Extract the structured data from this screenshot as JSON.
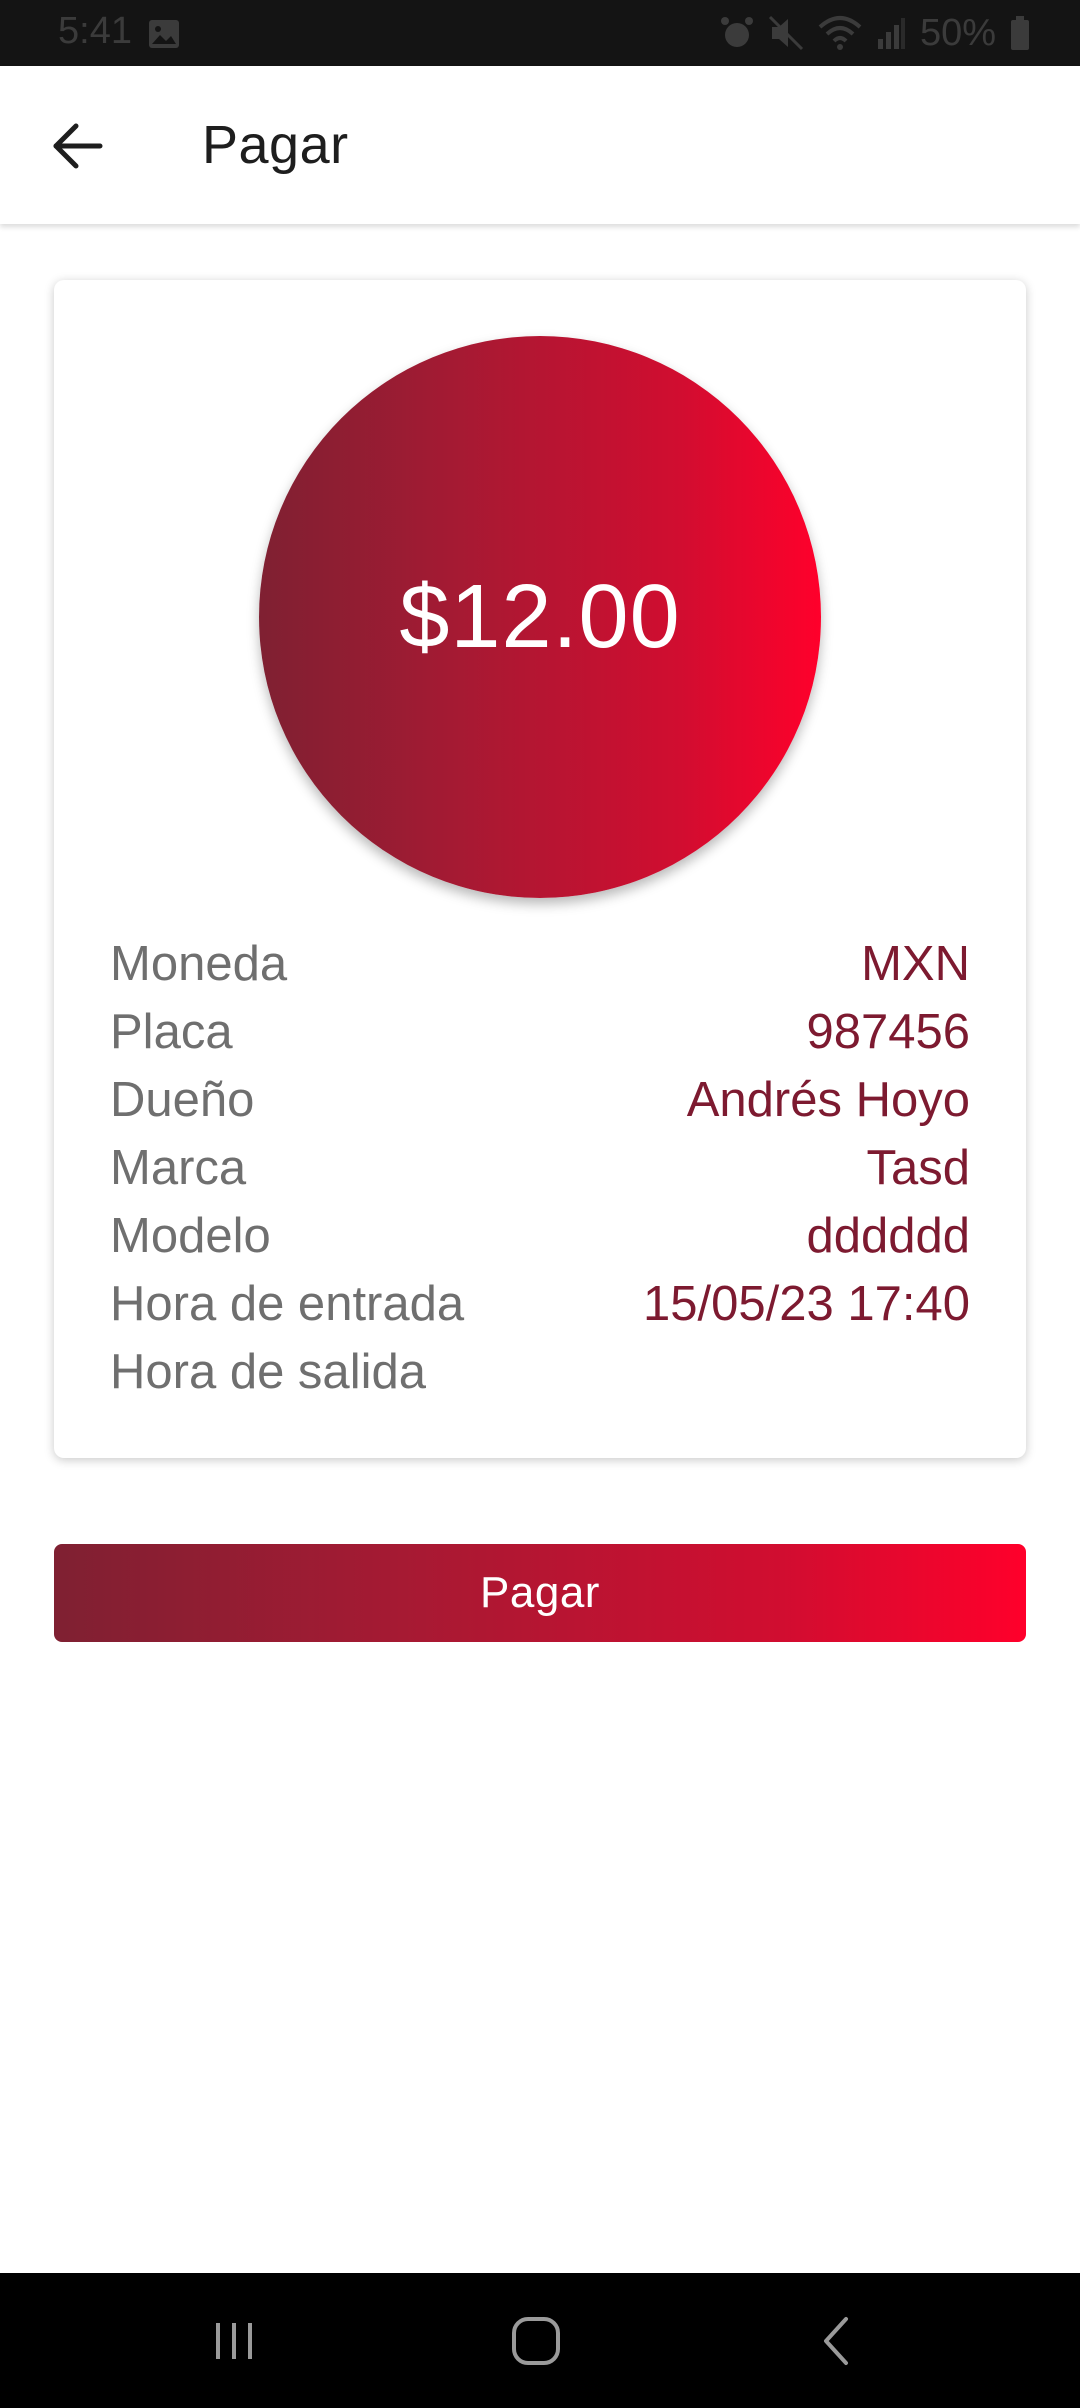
{
  "status_bar": {
    "time": "5:41",
    "battery": "50%",
    "icons": [
      "photo-icon",
      "alarm-icon",
      "mute-icon",
      "wifi-icon",
      "signal-icon",
      "battery-icon"
    ]
  },
  "header": {
    "title": "Pagar",
    "back_icon": "arrow-left-icon"
  },
  "payment": {
    "amount": "$12.00",
    "details": [
      {
        "label": "Moneda",
        "value": "MXN"
      },
      {
        "label": "Placa",
        "value": "987456"
      },
      {
        "label": "Dueño",
        "value": "Andrés Hoyo"
      },
      {
        "label": "Marca",
        "value": "Tasd"
      },
      {
        "label": "Modelo",
        "value": "dddddd"
      },
      {
        "label": "Hora de entrada",
        "value": "15/05/23 17:40"
      },
      {
        "label": "Hora de salida",
        "value": ""
      }
    ]
  },
  "actions": {
    "pay_label": "Pagar"
  },
  "colors": {
    "gradient_start": "#7f2032",
    "gradient_end": "#ff002b",
    "value_text": "#7d1a30",
    "label_text": "#6f6f6f"
  },
  "nav_bar": {
    "icons": [
      "recent-apps-icon",
      "home-icon",
      "back-icon"
    ]
  }
}
